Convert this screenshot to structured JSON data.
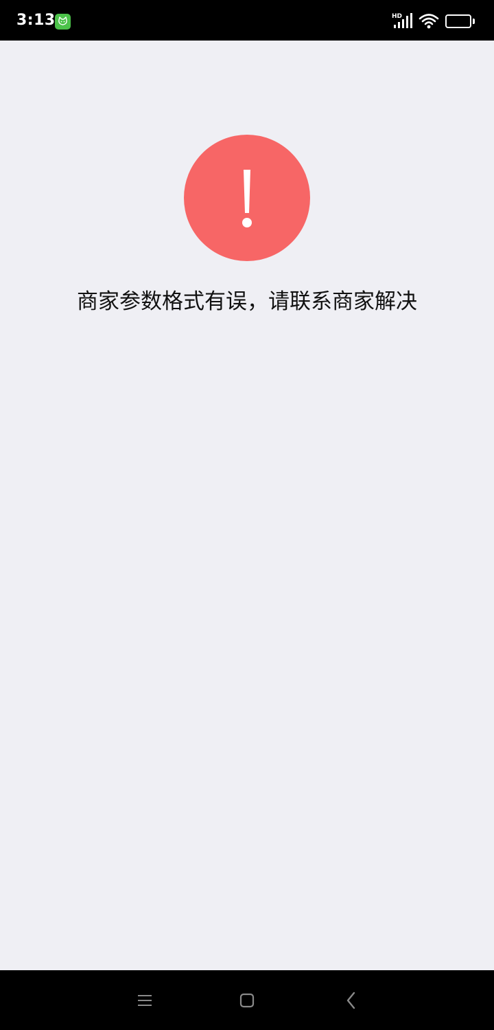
{
  "status_bar": {
    "time": "3:13",
    "network_label": "HD",
    "battery_level": "100",
    "icons": [
      "app-notification-icon",
      "signal-icon",
      "wifi-icon",
      "battery-icon"
    ]
  },
  "error": {
    "icon": "exclamation-icon",
    "icon_color": "#f76666",
    "message": "商家参数格式有误，请联系商家解决"
  },
  "nav_bar": {
    "icons": [
      "menu-icon",
      "home-icon",
      "back-icon"
    ]
  }
}
